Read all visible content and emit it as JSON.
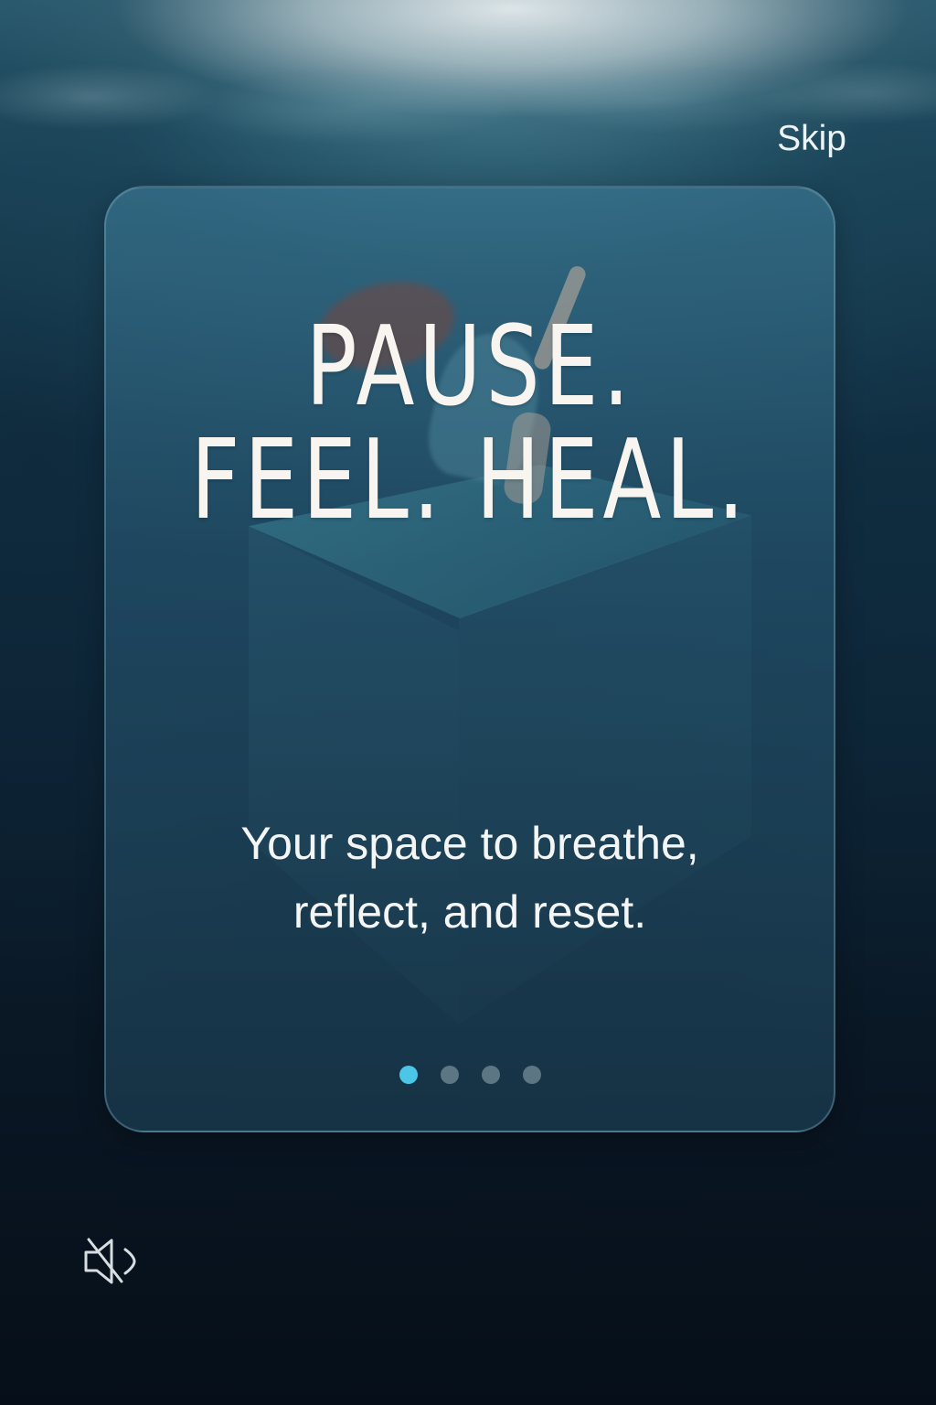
{
  "skip": {
    "label": "Skip"
  },
  "hero": {
    "headline_line_1": "Pause.",
    "headline_line_2": "Feel. Heal.",
    "subtitle_line_1": "Your space to breathe,",
    "subtitle_line_2": "reflect, and reset."
  },
  "pagination": {
    "current_page": 1,
    "total_pages": 4
  },
  "icons": {
    "mute": "speaker-muted-icon"
  },
  "colors": {
    "active_dot": "#4cc6e6",
    "inactive_dot": "#5c7683",
    "text": "#f8f5f0"
  }
}
